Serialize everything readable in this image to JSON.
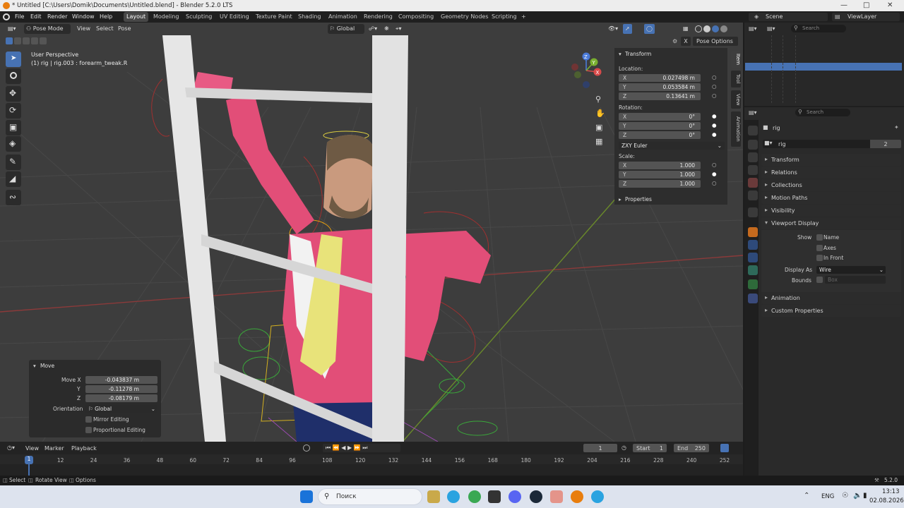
{
  "window": {
    "title": "* Untitled [C:\\Users\\Domik\\Documents\\Untitled.blend] - Blender 5.2.0 LTS"
  },
  "menu": [
    "File",
    "Edit",
    "Render",
    "Window",
    "Help"
  ],
  "workspaces": [
    "Layout",
    "Modeling",
    "Sculpting",
    "UV Editing",
    "Texture Paint",
    "Shading",
    "Animation",
    "Rendering",
    "Compositing",
    "Geometry Nodes",
    "Scripting"
  ],
  "workspace_add": "+",
  "scene": {
    "label": "Scene",
    "viewlayer": "ViewLayer"
  },
  "viewport": {
    "mode": "Pose Mode",
    "menus": [
      "View",
      "Select",
      "Pose"
    ],
    "orientation": "Global",
    "perspective": "User Perspective",
    "active": "(1) rig | rig.003 : forearm_tweak.R",
    "pose_options": "Pose Options",
    "close_x": "X"
  },
  "gizmo_axes": {
    "z": "Z",
    "y": "Y",
    "x": "X"
  },
  "npanel": {
    "transform_label": "Transform",
    "location_label": "Location:",
    "location": [
      {
        "k": "X",
        "v": "0.027498 m"
      },
      {
        "k": "Y",
        "v": "0.053584 m"
      },
      {
        "k": "Z",
        "v": "0.13641 m"
      }
    ],
    "rotation_label": "Rotation:",
    "rotation": [
      {
        "k": "X",
        "v": "0°"
      },
      {
        "k": "Y",
        "v": "0°"
      },
      {
        "k": "Z",
        "v": "0°"
      }
    ],
    "rotation_mode": "ZXY Euler",
    "scale_label": "Scale:",
    "scale": [
      {
        "k": "X",
        "v": "1.000"
      },
      {
        "k": "Y",
        "v": "1.000"
      },
      {
        "k": "Z",
        "v": "1.000"
      }
    ],
    "properties_label": "Properties",
    "tabs": [
      "Item",
      "Tool",
      "View",
      "Animation"
    ]
  },
  "redo": {
    "title": "Move",
    "move_x_label": "Move X",
    "move_x": "-0.043837 m",
    "y_label": "Y",
    "y": "-0.11278 m",
    "z_label": "Z",
    "z": "-0.08179 m",
    "orientation_label": "Orientation",
    "orientation": "Global",
    "mirror": "Mirror Editing",
    "proportional": "Proportional Editing"
  },
  "outliner": {
    "search_placeholder": "Search"
  },
  "properties": {
    "search_placeholder": "Search",
    "object": "rig",
    "data_name": "rig",
    "users": "2",
    "panels_top": [
      "Transform",
      "Relations",
      "Collections",
      "Motion Paths",
      "Visibility"
    ],
    "viewport_display": "Viewport Display",
    "show_label": "Show",
    "show_name": "Name",
    "show_axes": "Axes",
    "show_infront": "In Front",
    "display_as_label": "Display As",
    "display_as": "Wire",
    "bounds_label": "Bounds",
    "bounds": "Box",
    "panels_bottom": [
      "Animation",
      "Custom Properties"
    ]
  },
  "timeline": {
    "menus": [
      "View",
      "Marker",
      "Playback"
    ],
    "current_frame": "1",
    "start_label": "Start",
    "start": "1",
    "end_label": "End",
    "end": "250",
    "ticks": [
      "1",
      "12",
      "24",
      "36",
      "48",
      "60",
      "72",
      "84",
      "96",
      "108",
      "120",
      "132",
      "144",
      "156",
      "168",
      "180",
      "192",
      "204",
      "216",
      "228",
      "240",
      "252"
    ]
  },
  "status": {
    "select": "Select",
    "rotate": "Rotate View",
    "options": "Options",
    "version": "5.2.0"
  },
  "taskbar": {
    "search": "Поиск",
    "lang": "ENG",
    "time": "13:13",
    "date": "02.08.2026"
  },
  "colors": {
    "accent": "#4772b3",
    "viewport_bg": "#3d3d3d",
    "grid_x": "#8b3a3a",
    "grid_y": "#6a8a2a",
    "suit": "#e8507a",
    "tie": "#e8e37a",
    "ladder": "#e6e6e6"
  }
}
